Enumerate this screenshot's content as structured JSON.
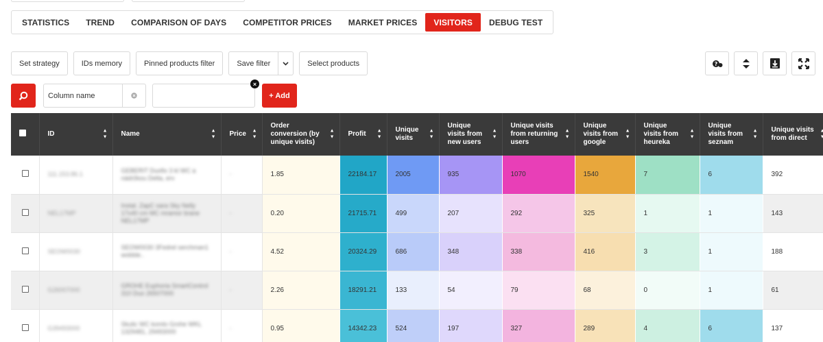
{
  "tabs": [
    "STATISTICS",
    "TREND",
    "COMPARISON OF DAYS",
    "COMPETITOR PRICES",
    "MARKET PRICES",
    "VISITORS",
    "DEBUG TEST"
  ],
  "active_tab": "VISITORS",
  "toolbar": {
    "set_strategy": "Set strategy",
    "ids_memory": "IDs memory",
    "pinned_filter": "Pinned products filter",
    "save_filter": "Save filter",
    "select_products": "Select products"
  },
  "filter": {
    "column_name_placeholder": "Column name",
    "add_label": "+ Add"
  },
  "colors": {
    "accent": "#e1251b",
    "header_bg": "#3a3a3a"
  },
  "table": {
    "headers": [
      "ID",
      "Name",
      "Price",
      "Order conversion (by unique visits)",
      "Profit",
      "Unique visits",
      "Unique visits from new users",
      "Unique visits from returning users",
      "Unique visits from google",
      "Unique visits from heureka",
      "Unique visits from seznam",
      "Unique visits from direct"
    ],
    "rows": [
      {
        "id": "111.153.86.1",
        "name": "GEBERIT Duofix 3 kl WC a nádržkou Delta, erv",
        "price": "-",
        "conversion": "1.85",
        "profit": "22184.17",
        "unique": "2005",
        "new": "935",
        "returning": "1070",
        "google": "1540",
        "heureka": "7",
        "seznam": "6",
        "direct": "392"
      },
      {
        "id": "NEL17MP",
        "name": "Instal. ZapC sara Sky Nelly 17x40 cm MC mramor brane NEL17MP",
        "price": "-",
        "conversion": "0.20",
        "profit": "21715.71",
        "unique": "499",
        "new": "207",
        "returning": "292",
        "google": "325",
        "heureka": "1",
        "seznam": "1",
        "direct": "143"
      },
      {
        "id": "SEOW0030",
        "name": "SEOW0030 3Fedrel serchman1 wobble..",
        "price": "-",
        "conversion": "4.52",
        "profit": "20324.29",
        "unique": "686",
        "new": "348",
        "returning": "338",
        "google": "416",
        "heureka": "3",
        "seznam": "1",
        "direct": "188"
      },
      {
        "id": "G26007000",
        "name": "GROHE Euphoria SmartControl 310 Duo 26507000",
        "price": "-",
        "conversion": "2.26",
        "profit": "18291.21",
        "unique": "133",
        "new": "54",
        "returning": "79",
        "google": "68",
        "heureka": "0",
        "seznam": "1",
        "direct": "61"
      },
      {
        "id": "G39493000",
        "name": "Skulic WC komlo Grohe WKL 1329481, 29493000",
        "price": "-",
        "conversion": "0.95",
        "profit": "14342.23",
        "unique": "524",
        "new": "197",
        "returning": "327",
        "google": "289",
        "heureka": "4",
        "seznam": "6",
        "direct": "137"
      }
    ],
    "cell_colors": [
      {
        "conversion": "#fffaeb",
        "profit": "#21a6c7",
        "unique": "#6f9af4",
        "new": "#a695f5",
        "returning": "#e83fb7",
        "google": "#e8a73c",
        "heureka": "#9ee0c5",
        "seznam": "#9fdcec",
        "direct": "#ffffff"
      },
      {
        "conversion": "#fffaeb",
        "profit": "#26aac9",
        "unique": "#c9d7fb",
        "new": "#e7e2fd",
        "returning": "#f5c6e8",
        "google": "#f7e4bd",
        "heureka": "#e6f9f1",
        "seznam": "#eefafd",
        "direct": "#efefef"
      },
      {
        "conversion": "#fffaeb",
        "profit": "#2eb0cd",
        "unique": "#b9cbf9",
        "new": "#d9d1fb",
        "returning": "#f4badf",
        "google": "#f7deb0",
        "heureka": "#d4f3e6",
        "seznam": "#eefafd",
        "direct": "#ffffff"
      },
      {
        "conversion": "#fffaeb",
        "profit": "#3ab6d2",
        "unique": "#e9effd",
        "new": "#f2effe",
        "returning": "#fbe0f2",
        "google": "#fcf1dc",
        "heureka": "#f2fcf8",
        "seznam": "#eefafd",
        "direct": "#efefef"
      },
      {
        "conversion": "#fffaeb",
        "profit": "#4ac0d8",
        "unique": "#bfcff9",
        "new": "#dfd8fc",
        "returning": "#f3b4df",
        "google": "#f8e2b8",
        "heureka": "#cdf0e1",
        "seznam": "#9fdcec",
        "direct": "#ffffff"
      }
    ]
  }
}
